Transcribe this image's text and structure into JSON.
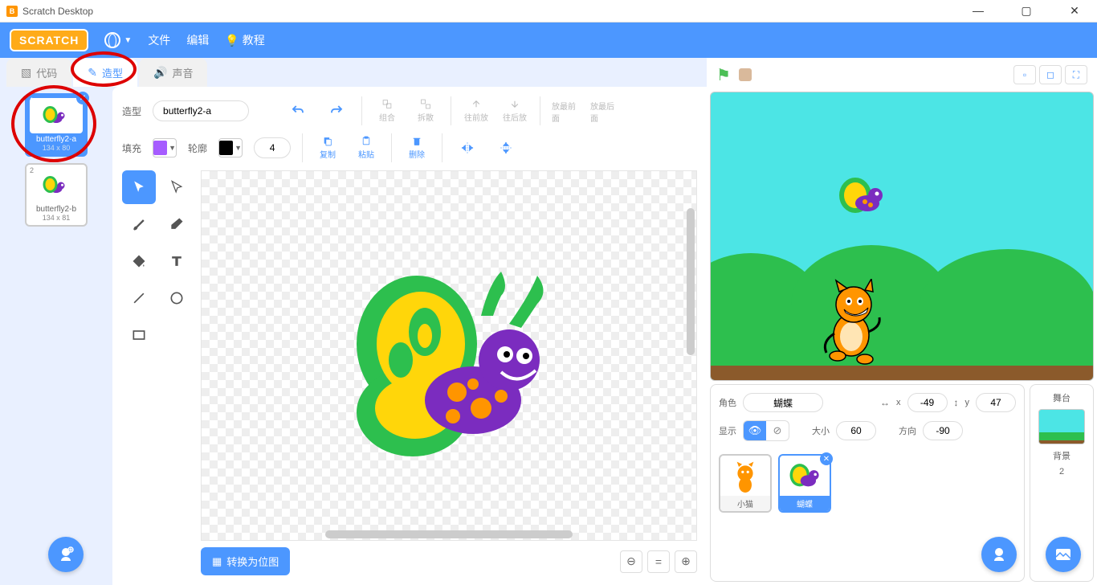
{
  "titlebar": {
    "title": "Scratch Desktop"
  },
  "menu": {
    "logo": "SCRATCH",
    "file": "文件",
    "edit": "编辑",
    "tutorials": "教程"
  },
  "tabs": {
    "code": "代码",
    "costumes": "造型",
    "sounds": "声音"
  },
  "costumes": [
    {
      "num": "1",
      "name": "butterfly2-a",
      "size": "134 x 80",
      "selected": true
    },
    {
      "num": "2",
      "name": "butterfly2-b",
      "size": "134 x 81",
      "selected": false
    }
  ],
  "paint": {
    "costume_label": "造型",
    "costume_name": "butterfly2-a",
    "group": "组合",
    "ungroup": "拆散",
    "forward": "往前放",
    "backward": "往后放",
    "front": "放最前面",
    "back": "放最后面",
    "fill_label": "填充",
    "outline_label": "轮廓",
    "outline_width": "4",
    "copy": "复制",
    "paste": "粘贴",
    "delete": "删除",
    "convert": "转换为位图",
    "fill_color": "#a65cff",
    "outline_color": "#000000"
  },
  "stage_controls": {
    "flag": "⚑",
    "stop": "⬣"
  },
  "sprite_info": {
    "sprite_label": "角色",
    "sprite_name": "蝴蝶",
    "x_label": "x",
    "x": "-49",
    "y_label": "y",
    "y": "47",
    "show_label": "显示",
    "size_label": "大小",
    "size": "60",
    "direction_label": "方向",
    "direction": "-90"
  },
  "sprites": [
    {
      "name": "小猫",
      "selected": false
    },
    {
      "name": "蝴蝶",
      "selected": true
    }
  ],
  "stage_panel": {
    "label": "舞台",
    "backdrop_label": "背景",
    "backdrop_count": "2"
  }
}
